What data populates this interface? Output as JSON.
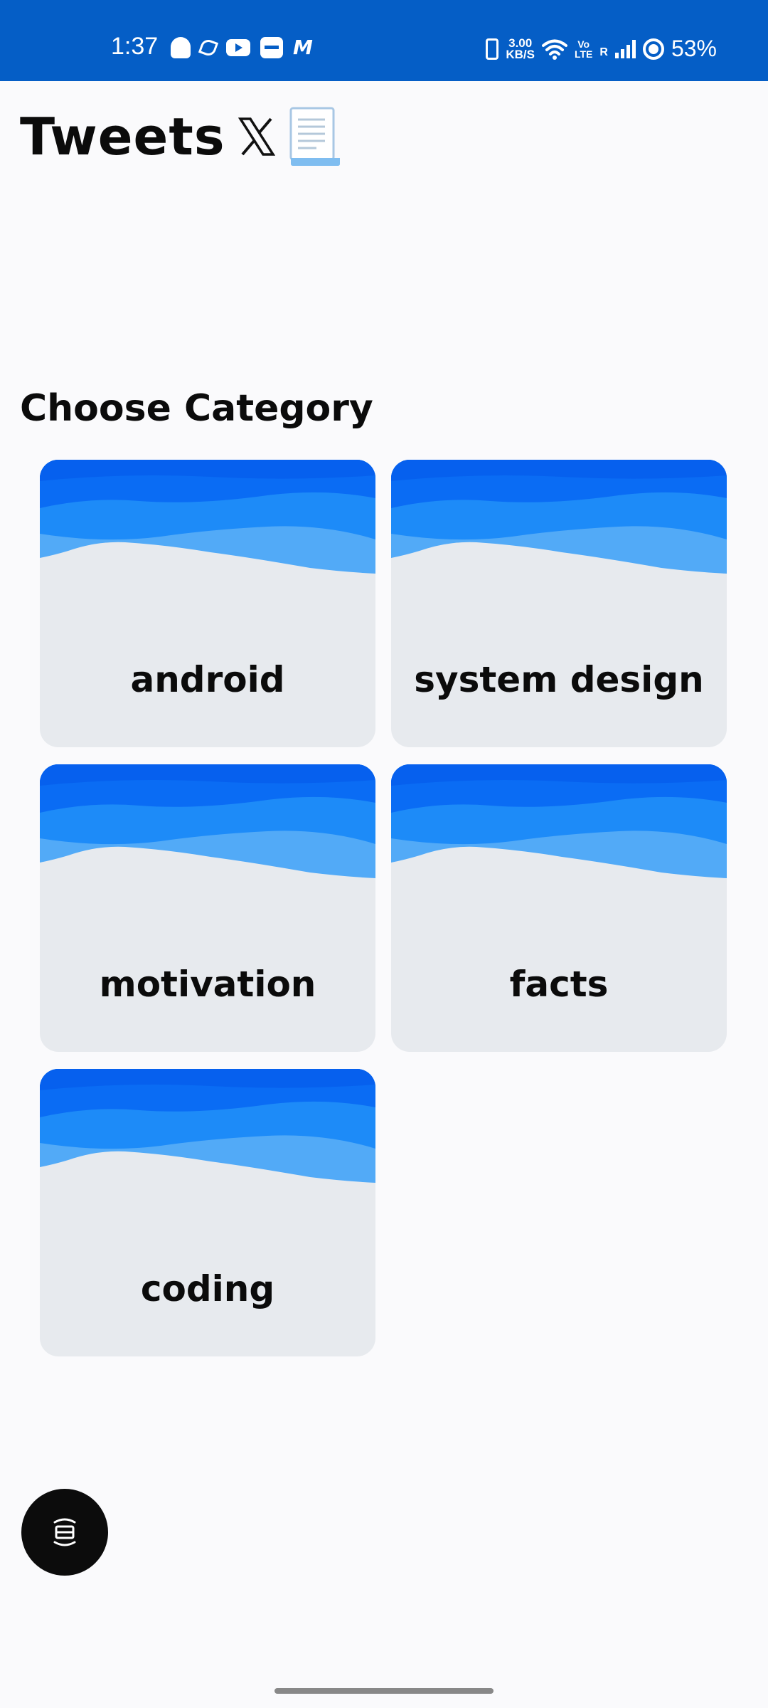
{
  "status_bar": {
    "time": "1:37",
    "speed_value": "3.00",
    "speed_unit": "KB/S",
    "volte_top": "Vo",
    "volte_bottom": "LTE",
    "roaming": "R",
    "battery": "53%",
    "notification_icons": [
      "snapchat-icon",
      "fitness-icon",
      "youtube-icon",
      "paytm-icon",
      "meesho-icon"
    ]
  },
  "header": {
    "title": "Tweets",
    "icons": [
      "x-logo-icon",
      "document-icon"
    ]
  },
  "section_title": "Choose Category",
  "categories": [
    {
      "label": "android"
    },
    {
      "label": "system design"
    },
    {
      "label": "motivation"
    },
    {
      "label": "facts"
    },
    {
      "label": "coding"
    }
  ],
  "fab": {
    "icon": "screen-rotate-icon"
  },
  "colors": {
    "status_bar_bg": "#055ec6",
    "card_bg": "#e7eaee",
    "wave_dark": "#0a6cf4",
    "wave_mid": "#1d8bf8",
    "wave_light": "#52aaf7",
    "fab_bg": "#0c0c0c"
  }
}
